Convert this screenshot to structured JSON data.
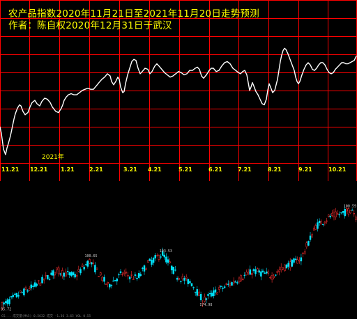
{
  "title_line1": "农产品指数2020年11月21日至2021年11月20日走势预测",
  "title_line2": "作者：陈自权2020年12月31日于武汉",
  "year_marker": "2021年",
  "colors": {
    "background": "#000000",
    "grid": "#ff0000",
    "forecast_line": "#ffffff",
    "label_text": "#ffff00",
    "candle_up": "#ff3030",
    "candle_down": "#00e5ff",
    "candle_label": "#cccccc"
  },
  "kline_labels": {
    "high_1": "100.65",
    "high_2": "103.53",
    "low_1": "174.98",
    "last_high": "100.59",
    "start_low": "95.72"
  },
  "footer_text": "CS... 成交量(MA5) 0.5632 成交 -1.36 3.65 VOL 0.55",
  "chart_data": [
    {
      "type": "line",
      "title": "农产品指数2020年11月21日至2021年11月20日走势预测",
      "xlabel": "",
      "ylabel": "",
      "grid": true,
      "x_ticks": [
        "11.21",
        "12.21",
        "1.21",
        "2.21",
        "3.21",
        "4.21",
        "5.21",
        "6.21",
        "7.21",
        "8.21",
        "9.21",
        "10.21"
      ],
      "series": [
        {
          "values": [
            [
              0,
              55
            ],
            [
              2,
              49
            ],
            [
              5,
              35
            ],
            [
              8,
              30
            ],
            [
              10,
              36
            ],
            [
              12,
              40
            ],
            [
              15,
              47
            ],
            [
              18,
              56
            ],
            [
              20,
              62
            ],
            [
              22,
              67
            ],
            [
              25,
              72
            ],
            [
              28,
              75
            ],
            [
              30,
              74
            ],
            [
              33,
              69
            ],
            [
              36,
              66
            ],
            [
              40,
              68
            ],
            [
              43,
              73
            ],
            [
              46,
              77
            ],
            [
              50,
              79
            ],
            [
              53,
              76
            ],
            [
              57,
              74
            ],
            [
              60,
              78
            ],
            [
              64,
              81
            ],
            [
              68,
              80
            ],
            [
              72,
              77
            ],
            [
              75,
              73
            ],
            [
              80,
              69
            ],
            [
              84,
              68
            ],
            [
              88,
              72
            ],
            [
              90,
              75
            ],
            [
              92,
              79
            ],
            [
              95,
              82
            ],
            [
              98,
              84
            ],
            [
              102,
              85
            ],
            [
              106,
              84
            ],
            [
              110,
              84
            ],
            [
              114,
              86
            ],
            [
              118,
              88
            ],
            [
              122,
              89
            ],
            [
              126,
              90
            ],
            [
              130,
              89
            ],
            [
              134,
              89
            ],
            [
              138,
              92
            ],
            [
              142,
              95
            ],
            [
              146,
              98
            ],
            [
              150,
              100
            ],
            [
              154,
              103
            ],
            [
              158,
              101
            ],
            [
              160,
              96
            ],
            [
              163,
              93
            ],
            [
              166,
              96
            ],
            [
              169,
              100
            ],
            [
              171,
              98
            ],
            [
              173,
              91
            ],
            [
              176,
              86
            ],
            [
              178,
              87
            ],
            [
              180,
              94
            ],
            [
              183,
              102
            ],
            [
              186,
              108
            ],
            [
              189,
              114
            ],
            [
              192,
              116
            ],
            [
              195,
              115
            ],
            [
              198,
              108
            ],
            [
              201,
              103
            ],
            [
              204,
              105
            ],
            [
              208,
              108
            ],
            [
              212,
              107
            ],
            [
              215,
              103
            ],
            [
              218,
              105
            ],
            [
              222,
              110
            ],
            [
              225,
              112
            ],
            [
              228,
              110
            ],
            [
              232,
              107
            ],
            [
              236,
              104
            ],
            [
              240,
              102
            ],
            [
              244,
              100
            ],
            [
              248,
              101
            ],
            [
              252,
              103
            ],
            [
              256,
              105
            ],
            [
              260,
              104
            ],
            [
              264,
              102
            ],
            [
              268,
              103
            ],
            [
              272,
              106
            ],
            [
              276,
              106
            ],
            [
              280,
              108
            ],
            [
              283,
              109
            ],
            [
              286,
              107
            ],
            [
              289,
              101
            ],
            [
              292,
              99
            ],
            [
              296,
              102
            ],
            [
              300,
              106
            ],
            [
              303,
              108
            ],
            [
              306,
              108
            ],
            [
              310,
              105
            ],
            [
              314,
              106
            ],
            [
              318,
              110
            ],
            [
              322,
              113
            ],
            [
              326,
              114
            ],
            [
              330,
              112
            ],
            [
              334,
              108
            ],
            [
              338,
              106
            ],
            [
              342,
              104
            ],
            [
              345,
              103
            ],
            [
              348,
              105
            ],
            [
              351,
              106
            ],
            [
              354,
              102
            ],
            [
              356,
              95
            ],
            [
              358,
              88
            ],
            [
              360,
              91
            ],
            [
              362,
              95
            ],
            [
              364,
              92
            ],
            [
              367,
              87
            ],
            [
              370,
              84
            ],
            [
              373,
              80
            ],
            [
              376,
              76
            ],
            [
              379,
              75
            ],
            [
              382,
              80
            ],
            [
              384,
              88
            ],
            [
              386,
              94
            ],
            [
              388,
              91
            ],
            [
              391,
              86
            ],
            [
              394,
              88
            ],
            [
              396,
              93
            ],
            [
              398,
              98
            ],
            [
              400,
              106
            ],
            [
              402,
              114
            ],
            [
              404,
              120
            ],
            [
              406,
              124
            ],
            [
              408,
              126
            ],
            [
              410,
              125
            ],
            [
              413,
              121
            ],
            [
              416,
              116
            ],
            [
              419,
              111
            ],
            [
              422,
              106
            ],
            [
              424,
              100
            ],
            [
              426,
              96
            ],
            [
              428,
              94
            ],
            [
              430,
              96
            ],
            [
              433,
              102
            ],
            [
              436,
              107
            ],
            [
              439,
              111
            ],
            [
              442,
              113
            ],
            [
              445,
              111
            ],
            [
              448,
              107
            ],
            [
              451,
              106
            ],
            [
              454,
              108
            ],
            [
              457,
              111
            ],
            [
              460,
              113
            ],
            [
              463,
              113
            ],
            [
              466,
              111
            ],
            [
              469,
              107
            ],
            [
              472,
              104
            ],
            [
              475,
              103
            ],
            [
              478,
              104
            ],
            [
              481,
              107
            ],
            [
              484,
              109
            ],
            [
              487,
              111
            ],
            [
              490,
              113
            ],
            [
              493,
              113
            ],
            [
              496,
              112
            ],
            [
              499,
              112
            ],
            [
              502,
              113
            ],
            [
              505,
              114
            ],
            [
              508,
              115
            ],
            [
              511,
              119
            ]
          ]
        }
      ],
      "xlim": [
        0,
        511
      ],
      "ylim": [
        25,
        135
      ]
    },
    {
      "type": "candlestick",
      "title": "",
      "grid": false,
      "count": 195,
      "ylim": [
        90,
        140
      ],
      "annotations": [
        {
          "text": "100.65",
          "index": 48
        },
        {
          "text": "103.53",
          "index": 89
        },
        {
          "text": "174.98",
          "index": 111
        },
        {
          "text": "100.59",
          "index": 190
        },
        {
          "text": "95.72",
          "index": 2
        }
      ]
    }
  ]
}
